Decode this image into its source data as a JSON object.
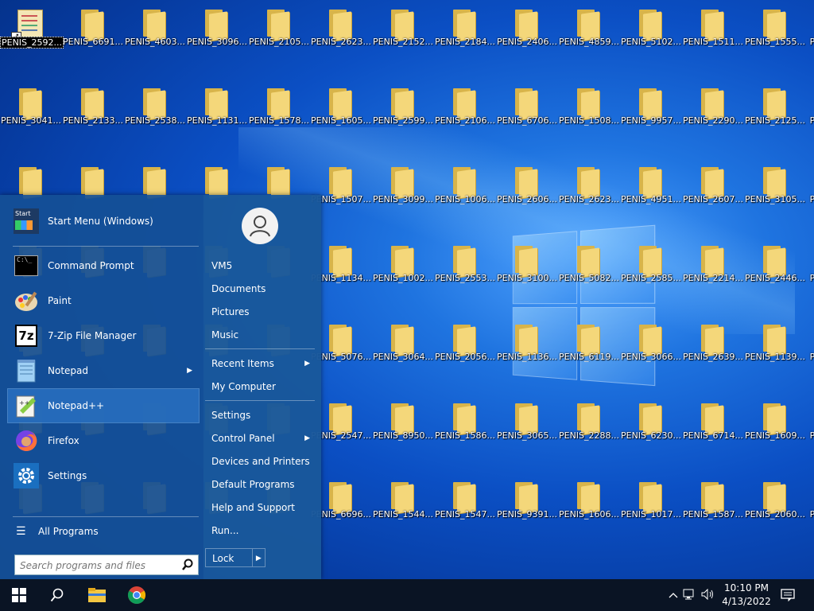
{
  "desktop": {
    "rows": [
      [
        "PENIS_2592...",
        "PENIS_6691...",
        "PENIS_4603...",
        "PENIS_3096...",
        "PENIS_2105...",
        "PENIS_2623...",
        "PENIS_2152...",
        "PENIS_2184...",
        "PENIS_2406...",
        "PENIS_4859...",
        "PENIS_5102...",
        "PENIS_1511...",
        "PENIS_1555..."
      ],
      [
        "PENIS_3041...",
        "PENIS_2133...",
        "PENIS_2538...",
        "PENIS_1131...",
        "PENIS_1578...",
        "PENIS_1605...",
        "PENIS_2599...",
        "PENIS_2106...",
        "PENIS_6706...",
        "PENIS_1508...",
        "PENIS_9957...",
        "PENIS_2290...",
        "PENIS_2125..."
      ],
      [
        "",
        "",
        "",
        "",
        "",
        "PENIS_1507...",
        "PENIS_3099...",
        "PENIS_1006...",
        "PENIS_2606...",
        "PENIS_2623...",
        "PENIS_4951...",
        "PENIS_2607...",
        "PENIS_3105..."
      ],
      [
        "",
        "",
        "",
        "",
        "",
        "PENIS_1134...",
        "PENIS_1002...",
        "PENIS_2553...",
        "PENIS_3100...",
        "PENIS_5082...",
        "PENIS_2585...",
        "PENIS_2214...",
        "PENIS_2446..."
      ],
      [
        "",
        "",
        "",
        "",
        "",
        "PENIS_5076...",
        "PENIS_3064...",
        "PENIS_2056...",
        "PENIS_1136...",
        "PENIS_6119...",
        "PENIS_3066...",
        "PENIS_2639...",
        "PENIS_1139..."
      ],
      [
        "",
        "",
        "",
        "",
        "",
        "PENIS_2547...",
        "PENIS_8950...",
        "PENIS_1586...",
        "PENIS_3065...",
        "PENIS_2288...",
        "PENIS_6230...",
        "PENIS_6714...",
        "PENIS_1609..."
      ],
      [
        "",
        "",
        "",
        "",
        "",
        "PENIS_6696...",
        "PENIS_1544...",
        "PENIS_1547...",
        "PENIS_9391...",
        "PENIS_1606...",
        "PENIS_1017...",
        "PENIS_1587...",
        "PENIS_2060..."
      ]
    ],
    "edge_label": "P"
  },
  "start_menu": {
    "pinned": [
      {
        "label": "Start Menu (Windows)",
        "icon": "start-menu-icon"
      },
      {
        "label": "Command Prompt",
        "icon": "command-prompt-icon"
      },
      {
        "label": "Paint",
        "icon": "paint-icon"
      },
      {
        "label": "7-Zip File Manager",
        "icon": "7zip-icon"
      },
      {
        "label": "Notepad",
        "icon": "notepad-icon",
        "submenu": true
      },
      {
        "label": "Notepad++",
        "icon": "notepadpp-icon"
      },
      {
        "label": "Firefox",
        "icon": "firefox-icon"
      },
      {
        "label": "Settings",
        "icon": "settings-gear-icon"
      }
    ],
    "all_programs": "All Programs",
    "search_placeholder": "Search programs and files",
    "user": "VM5",
    "right_items": [
      {
        "label": "VM5"
      },
      {
        "label": "Documents"
      },
      {
        "label": "Pictures"
      },
      {
        "label": "Music"
      },
      {
        "label": "Recent Items",
        "submenu": true
      },
      {
        "label": "My Computer"
      },
      {
        "label": "Settings"
      },
      {
        "label": "Control Panel",
        "submenu": true
      },
      {
        "label": "Devices and Printers"
      },
      {
        "label": "Default Programs"
      },
      {
        "label": "Help and Support"
      },
      {
        "label": "Run..."
      }
    ],
    "lock_label": "Lock",
    "arrow_glyph": "▶",
    "start_icon_text": "Start",
    "sevenzip_text": "7z"
  },
  "taskbar": {
    "time": "10:10 PM",
    "date": "4/13/2022"
  }
}
